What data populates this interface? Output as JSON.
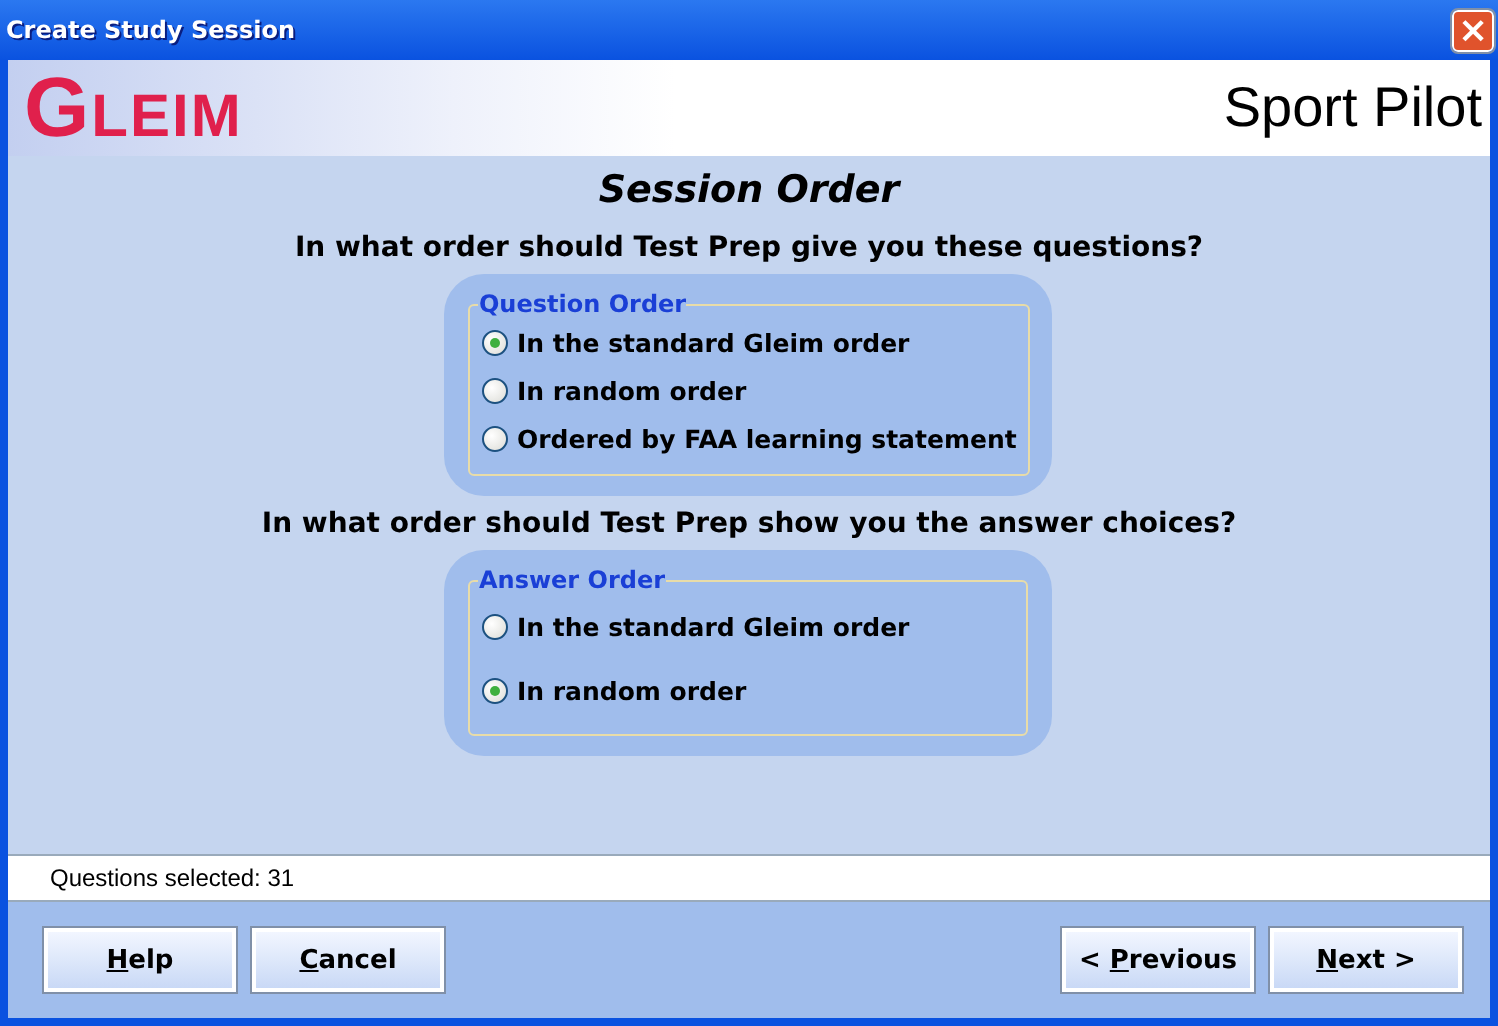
{
  "window": {
    "title": "Create Study Session",
    "close": "×"
  },
  "header": {
    "logo": "GLEIM",
    "product": "Sport Pilot"
  },
  "heading": "Session Order",
  "groups": [
    {
      "question": "In what order should Test Prep give you these questions?",
      "legend": "Question Order",
      "options": [
        {
          "label": "In the standard Gleim order",
          "selected": true
        },
        {
          "label": "In random order",
          "selected": false
        },
        {
          "label": "Ordered by FAA learning statement",
          "selected": false
        }
      ]
    },
    {
      "question": "In what order should Test Prep show you the answer choices?",
      "legend": "Answer Order",
      "options": [
        {
          "label": "In the standard Gleim order",
          "selected": false
        },
        {
          "label": "In random order",
          "selected": true
        }
      ]
    }
  ],
  "status_bar": "Questions selected: 31",
  "left_buttons": [
    {
      "key": "H",
      "rest": "elp"
    },
    {
      "key": "C",
      "rest": "ancel"
    }
  ],
  "right_buttons": [
    {
      "prefix": "< ",
      "key": "P",
      "rest": "revious"
    },
    {
      "key": "N",
      "rest": "ext >"
    }
  ]
}
